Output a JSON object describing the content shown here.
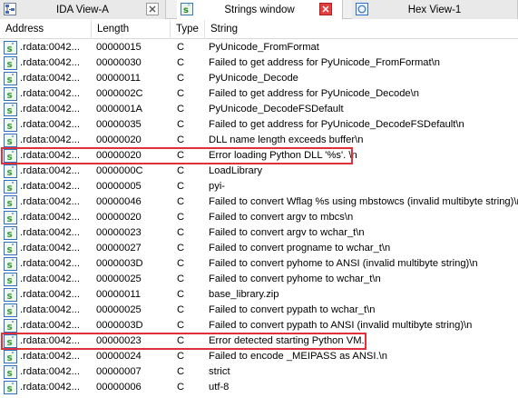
{
  "tabs": [
    {
      "label": "IDA View-A",
      "active": false
    },
    {
      "label": "Strings window",
      "active": true
    },
    {
      "label": "Hex View-1",
      "active": false
    }
  ],
  "columns": [
    "Address",
    "Length",
    "Type",
    "String"
  ],
  "rows": [
    {
      "address": ".rdata:0042...",
      "length": "00000015",
      "type": "C",
      "string": "PyUnicode_FromFormat"
    },
    {
      "address": ".rdata:0042...",
      "length": "00000030",
      "type": "C",
      "string": "Failed to get address for PyUnicode_FromFormat\\n"
    },
    {
      "address": ".rdata:0042...",
      "length": "00000011",
      "type": "C",
      "string": "PyUnicode_Decode"
    },
    {
      "address": ".rdata:0042...",
      "length": "0000002C",
      "type": "C",
      "string": "Failed to get address for PyUnicode_Decode\\n"
    },
    {
      "address": ".rdata:0042...",
      "length": "0000001A",
      "type": "C",
      "string": "PyUnicode_DecodeFSDefault"
    },
    {
      "address": ".rdata:0042...",
      "length": "00000035",
      "type": "C",
      "string": "Failed to get address for PyUnicode_DecodeFSDefault\\n"
    },
    {
      "address": ".rdata:0042...",
      "length": "00000020",
      "type": "C",
      "string": "DLL name length exceeds buffer\\n"
    },
    {
      "address": ".rdata:0042...",
      "length": "00000020",
      "type": "C",
      "string": "Error loading Python DLL '%s'. \\n"
    },
    {
      "address": ".rdata:0042...",
      "length": "0000000C",
      "type": "C",
      "string": "LoadLibrary"
    },
    {
      "address": ".rdata:0042...",
      "length": "00000005",
      "type": "C",
      "string": "pyi-"
    },
    {
      "address": ".rdata:0042...",
      "length": "00000046",
      "type": "C",
      "string": "Failed to convert Wflag %s using mbstowcs (invalid multibyte string)\\n"
    },
    {
      "address": ".rdata:0042...",
      "length": "00000020",
      "type": "C",
      "string": "Failed to convert argv to mbcs\\n"
    },
    {
      "address": ".rdata:0042...",
      "length": "00000023",
      "type": "C",
      "string": "Failed to convert argv to wchar_t\\n"
    },
    {
      "address": ".rdata:0042...",
      "length": "00000027",
      "type": "C",
      "string": "Failed to convert progname to wchar_t\\n"
    },
    {
      "address": ".rdata:0042...",
      "length": "0000003D",
      "type": "C",
      "string": "Failed to convert pyhome to ANSI (invalid multibyte string)\\n"
    },
    {
      "address": ".rdata:0042...",
      "length": "00000025",
      "type": "C",
      "string": "Failed to convert pyhome to wchar_t\\n"
    },
    {
      "address": ".rdata:0042...",
      "length": "00000011",
      "type": "C",
      "string": "base_library.zip"
    },
    {
      "address": ".rdata:0042...",
      "length": "00000025",
      "type": "C",
      "string": "Failed to convert pypath to wchar_t\\n"
    },
    {
      "address": ".rdata:0042...",
      "length": "0000003D",
      "type": "C",
      "string": "Failed to convert pypath to ANSI (invalid multibyte string)\\n"
    },
    {
      "address": ".rdata:0042...",
      "length": "00000023",
      "type": "C",
      "string": "Error detected starting Python VM."
    },
    {
      "address": ".rdata:0042...",
      "length": "00000024",
      "type": "C",
      "string": "Failed to encode _MEIPASS as ANSI.\\n"
    },
    {
      "address": ".rdata:0042...",
      "length": "00000007",
      "type": "C",
      "string": "strict"
    },
    {
      "address": ".rdata:0042...",
      "length": "00000006",
      "type": "C",
      "string": "utf-8"
    }
  ],
  "highlighted_rows": [
    7,
    19
  ],
  "colors": {
    "highlight": "#e0303a",
    "icon_green": "#3a9a3a",
    "icon_blue": "#2f6fc0"
  },
  "icons": {
    "row": "string-s-icon",
    "ida_view": "ida-graph-icon",
    "strings": "strings-s-icon",
    "hex_view": "hex-view-icon",
    "close": "close-icon"
  }
}
